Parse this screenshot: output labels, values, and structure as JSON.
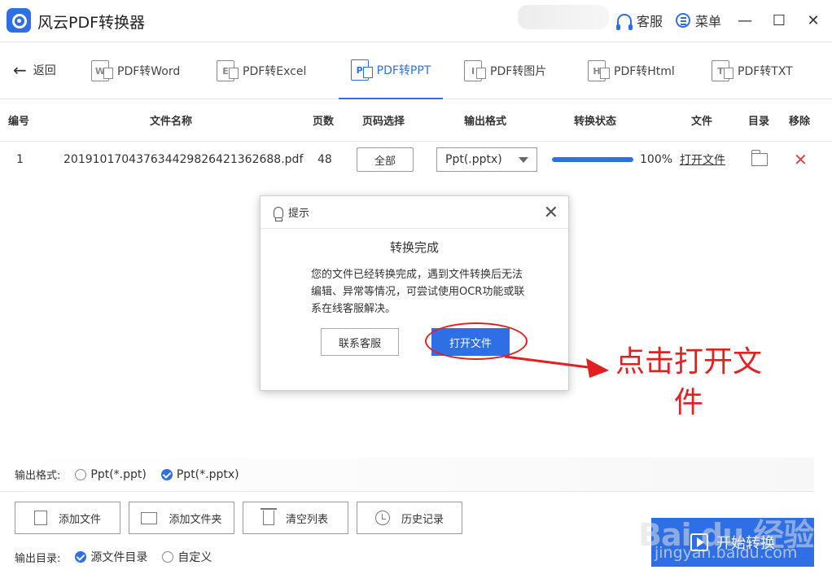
{
  "app": {
    "title": "风云PDF转换器",
    "support_label": "客服",
    "menu_label": "菜单",
    "minimize": "—",
    "maximize": "☐",
    "close": "✕"
  },
  "nav": {
    "back_label": "返回",
    "tabs": [
      {
        "label": "PDF转Word",
        "icon": "W",
        "active": false
      },
      {
        "label": "PDF转Excel",
        "icon": "E",
        "active": false
      },
      {
        "label": "PDF转PPT",
        "icon": "P",
        "active": true
      },
      {
        "label": "PDF转图片",
        "icon": "I",
        "active": false
      },
      {
        "label": "PDF转Html",
        "icon": "H",
        "active": false
      },
      {
        "label": "PDF转TXT",
        "icon": "T",
        "active": false
      }
    ]
  },
  "table": {
    "headers": {
      "index": "编号",
      "filename": "文件名称",
      "pages": "页数",
      "page_select": "页码选择",
      "output_format": "输出格式",
      "status": "转换状态",
      "file": "文件",
      "dir": "目录",
      "remove": "移除"
    },
    "rows": [
      {
        "index": "1",
        "filename": "20191017043763442982642136​2688.pdf",
        "pages": "48",
        "page_select": "全部",
        "format": "Ppt(.pptx)",
        "progress": 1.0,
        "progress_text": "100%",
        "open_file": "打开文件"
      }
    ]
  },
  "modal": {
    "header": "提示",
    "title": "转换完成",
    "message": "您的文件已经转换完成，遇到文件转换后无法编辑、异常等情况，可尝试使用OCR功能或联系在线客服解决。",
    "contact_button": "联系客服",
    "open_button": "打开文件"
  },
  "annotation": {
    "text": "点击打开文件",
    "color": "#e41f1f"
  },
  "output_format": {
    "label": "输出格式:",
    "options": [
      {
        "label": "Ppt(*.ppt)",
        "selected": false
      },
      {
        "label": "Ppt(*.pptx)",
        "selected": true
      }
    ]
  },
  "toolbar": {
    "add_file": "添加文件",
    "add_folder": "添加文件夹",
    "clear_list": "清空列表",
    "history": "历史记录"
  },
  "output_dir": {
    "label": "输出目录:",
    "options": [
      {
        "label": "源文件目录",
        "selected": true
      },
      {
        "label": "自定义",
        "selected": false
      }
    ]
  },
  "start_button": "开始转换",
  "watermark": {
    "main": "Bai du 经验",
    "sub": "jingyan.baidu.com"
  },
  "colors": {
    "accent": "#2f6fe6",
    "remove": "#e04040"
  }
}
